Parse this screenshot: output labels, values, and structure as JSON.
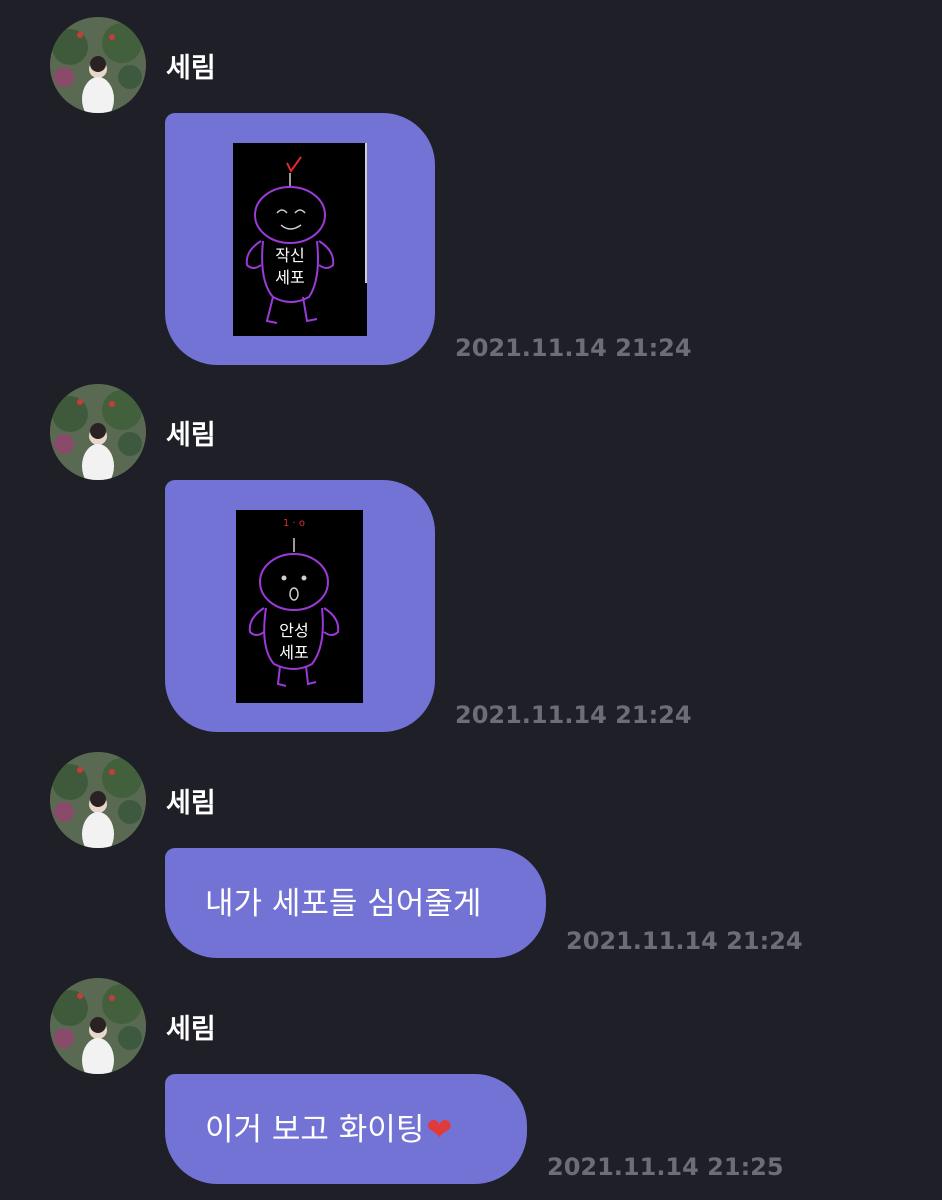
{
  "messages": [
    {
      "sender": "세림",
      "kind": "image",
      "time": "2021.11.14 21:24",
      "image_text_lines": [
        "작신",
        "세포"
      ]
    },
    {
      "sender": "세림",
      "kind": "image",
      "time": "2021.11.14 21:24",
      "image_text_lines": [
        "안성",
        "세포"
      ]
    },
    {
      "sender": "세림",
      "kind": "text",
      "text": "내가 세포들 심어줄게",
      "time": "2021.11.14 21:24"
    },
    {
      "sender": "세림",
      "kind": "text",
      "text": "이거 보고 화이팅",
      "emoji": "❤",
      "time": "2021.11.14 21:25"
    }
  ],
  "colors": {
    "background": "#1f1f27",
    "bubble": "#7373d6",
    "timestamp": "#6d6d76",
    "doodle_outline": "#9b3ad9",
    "doodle_accent": "#e02a2a",
    "heart": "#e03a3a"
  },
  "icons": {
    "avatar": "profile-photo",
    "heart": "heart-emoji"
  }
}
